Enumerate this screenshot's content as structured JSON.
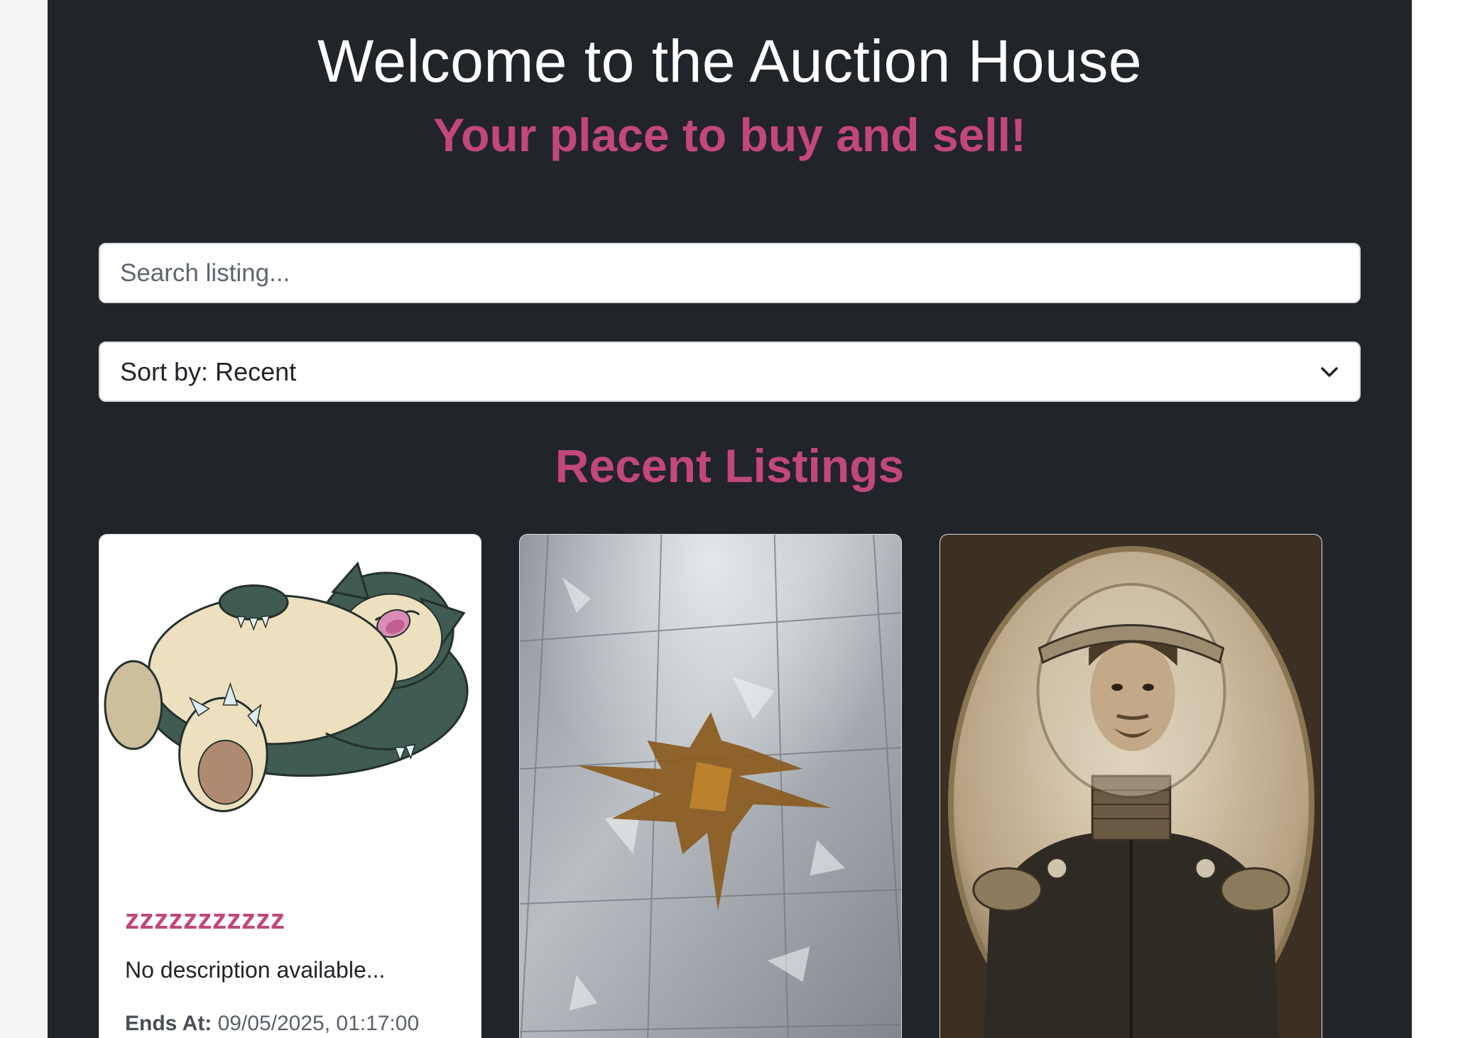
{
  "header": {
    "title": "Welcome to the Auction House",
    "subtitle": "Your place to buy and sell!"
  },
  "search": {
    "placeholder": "Search listing..."
  },
  "sort": {
    "label": "Sort by: Recent"
  },
  "listings_section": {
    "heading": "Recent Listings"
  },
  "listings": [
    {
      "title": "zzzzzzzzzzz",
      "description": "No description available...",
      "ends_label": "Ends At:",
      "ends_value": "09/05/2025, 01:17:00",
      "image": "sleeping-creature-illustration"
    },
    {
      "image": "marble-floor-spill-photo"
    },
    {
      "image": "vintage-astronaut-portrait"
    }
  ],
  "colors": {
    "page_background": "#212429",
    "accent": "#c2477b",
    "card_background": "#ffffff"
  }
}
